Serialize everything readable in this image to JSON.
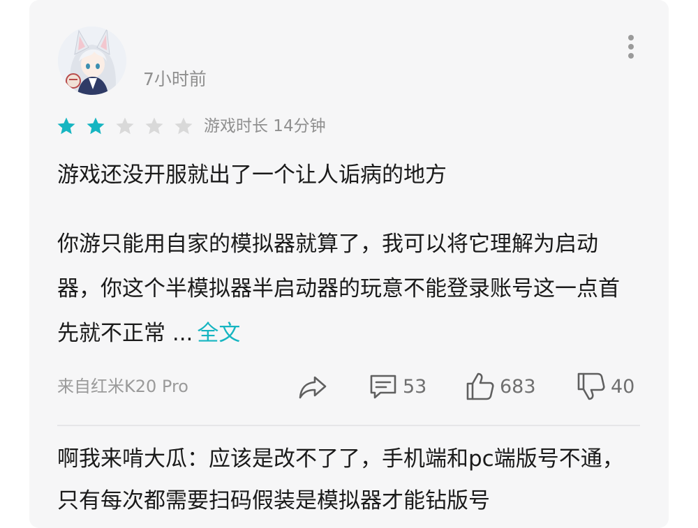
{
  "review": {
    "time_ago": "7小时前",
    "rating": 2,
    "max_rating": 5,
    "playtime": "游戏时长 14分钟",
    "title": "游戏还没开服就出了一个让人诟病的地方",
    "body": "你游只能用自家的模拟器就算了，我可以将它理解为启动器，你这个半模拟器半启动器的玩意不能登录账号这一点首先就不正常",
    "ellipsis": " ...",
    "full_text_label": "全文",
    "device": "来自红米K20 Pro",
    "comments_count": "53",
    "likes_count": "683",
    "dislikes_count": "40"
  },
  "reply": {
    "text": "啊我来啃大瓜：应该是改不了了，手机端和pc端版号不通，只有每次都需要扫码假装是模拟器才能钻版号"
  },
  "colors": {
    "star_filled": "#16b5c1",
    "star_empty": "#d9d9d9",
    "link": "#16b5c1",
    "card_bg": "#f6f6f7"
  },
  "icons": [
    "avatar-fox-girl",
    "more-vert-icon",
    "star-icon",
    "share-icon",
    "comment-icon",
    "thumbs-up-icon",
    "thumbs-down-icon"
  ]
}
